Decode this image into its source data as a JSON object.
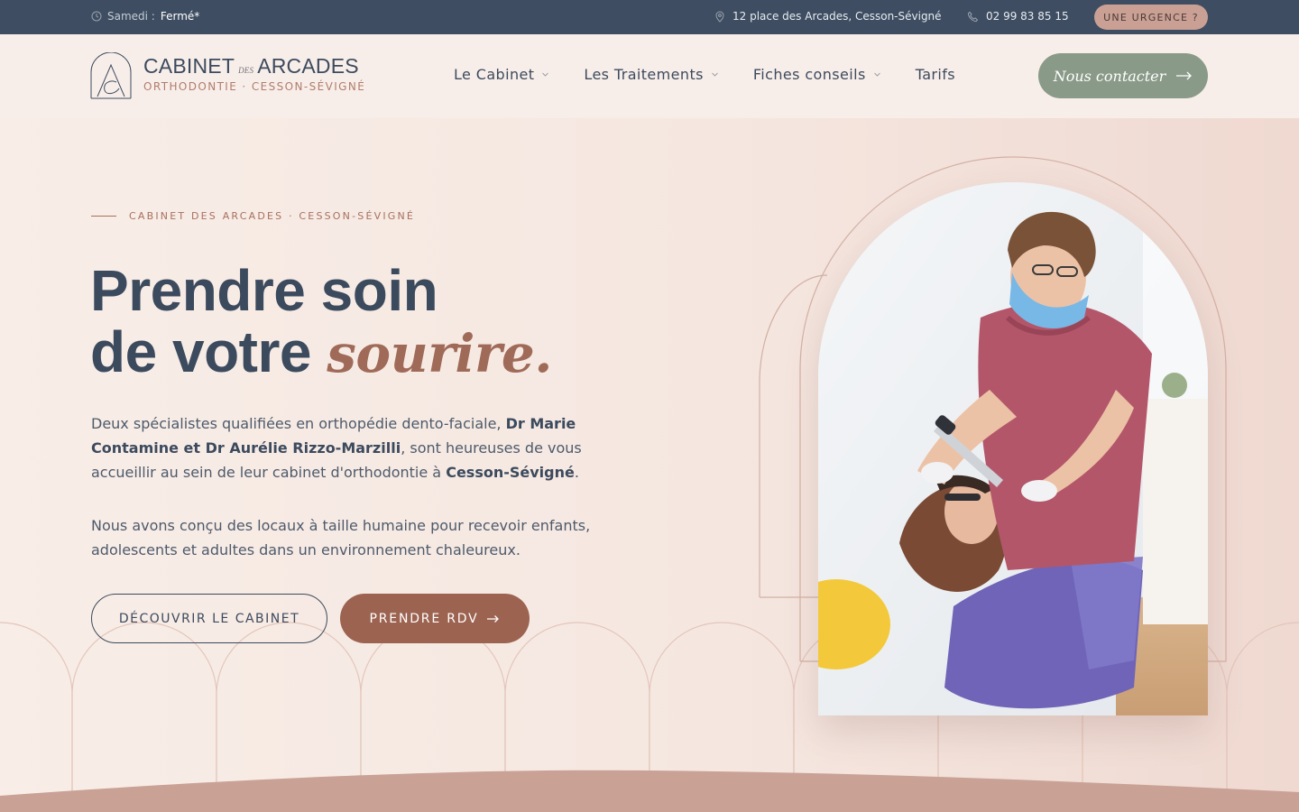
{
  "topbar": {
    "hours_day": "Samedi :",
    "hours_status": "Fermé*",
    "address": "12 place des Arcades, Cesson-Sévigné",
    "phone": "02 99 83 85 15",
    "urgence_label": "UNE URGENCE ?"
  },
  "header": {
    "logo_word1": "CABINET",
    "logo_des": "DES",
    "logo_word2": "ARCADES",
    "logo_subtitle": "ORTHODONTIE · CESSON-SÉVIGNÉ",
    "nav": [
      {
        "label": "Le Cabinet",
        "has_dropdown": true
      },
      {
        "label": "Les Traitements",
        "has_dropdown": true
      },
      {
        "label": "Fiches conseils",
        "has_dropdown": true
      },
      {
        "label": "Tarifs",
        "has_dropdown": false
      }
    ],
    "contact_label": "Nous contacter"
  },
  "hero": {
    "eyebrow": "CABINET DES ARCADES · CESSON-SÉVIGNÉ",
    "headline_line1": "Prendre soin",
    "headline_line2": "de votre",
    "headline_accent": "sourire.",
    "para1_text1": "Deux spécialistes qualifiées en orthopédie dento-faciale,",
    "para1_bold1": "Dr Marie Contamine et Dr Aurélie Rizzo-Marzilli",
    "para1_text2": ", sont heureuses de vous accueillir au sein de leur cabinet d'orthodontie à",
    "para1_bold2": "Cesson-Sévigné",
    "para1_text3": ".",
    "para2": "Nous avons conçu des locaux à taille humaine pour recevoir enfants, adolescents et adultes dans un environnement chaleureux.",
    "btn_discover": "DÉCOUVRIR LE CABINET",
    "btn_rdv": "PRENDRE RDV"
  },
  "colors": {
    "navy": "#3e4d61",
    "terracotta": "#9c6350",
    "sage": "#8a9a88",
    "blush": "#caa095",
    "background": "#f7ece6"
  },
  "icons": {
    "clock": "clock-icon",
    "pin": "map-pin-icon",
    "phone": "phone-icon",
    "arrow": "arrow-right-icon",
    "chevron": "chevron-down-icon"
  }
}
